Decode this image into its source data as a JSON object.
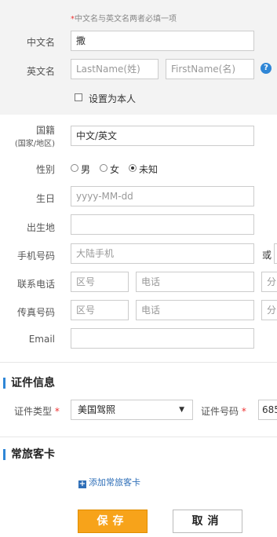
{
  "name_section": {
    "note_star": "*",
    "note": "中文名与英文名两者必填一项",
    "cn_label": "中文名",
    "cn_value": "撒",
    "en_label": "英文名",
    "last_placeholder": "LastName(姓)",
    "first_placeholder": "FirstName(名)",
    "help_icon": "?",
    "self_label": "设置为本人"
  },
  "personal": {
    "nation_label": "国籍",
    "nation_sub": "(国家/地区)",
    "nation_value": "中文/英文",
    "gender_label": "性别",
    "gender_options": [
      "男",
      "女",
      "未知"
    ],
    "gender_selected": "未知",
    "birth_label": "生日",
    "birth_placeholder": "yyyy-MM-dd",
    "birthplace_label": "出生地",
    "mobile_label": "手机号码",
    "mobile_placeholder": "大陆手机",
    "mobile_or": "或",
    "phone_label": "联系电话",
    "fax_label": "传真号码",
    "area_placeholder": "区号",
    "tel_placeholder": "电话",
    "ext_placeholder": "分",
    "email_label": "Email"
  },
  "id_section": {
    "title": "证件信息",
    "type_label": "证件类型",
    "req": "*",
    "type_value": "美国驾照",
    "arrow": "▼",
    "number_label": "证件号码",
    "number_value": "685"
  },
  "ff_section": {
    "title": "常旅客卡",
    "add_icon": "+",
    "add_label": "添加常旅客卡"
  },
  "actions": {
    "save": "保存",
    "cancel": "取消"
  },
  "colors": {
    "accent": "#2f86d6",
    "save_bg": "#f7a31a",
    "required": "#e33333"
  }
}
